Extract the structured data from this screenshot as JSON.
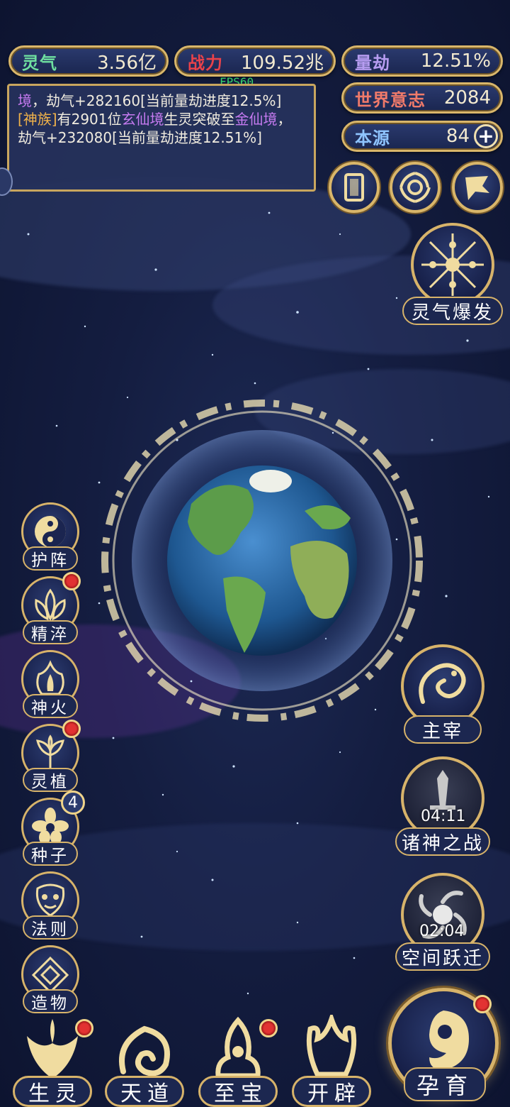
{
  "stats": {
    "lingqi": {
      "label": "灵气",
      "value": "3.56亿",
      "color": "#6fe0a0"
    },
    "zhanli": {
      "label": "战力",
      "value": "109.52兆",
      "color": "#e8424a"
    },
    "liangjie": {
      "label": "量劫",
      "value": "12.51%",
      "color": "#b69cf0"
    },
    "shijie": {
      "label": "世界意志",
      "value": "2084",
      "color": "#f07a6a"
    },
    "benyuan": {
      "label": "本源",
      "value": "84",
      "color": "#8fc4ff"
    }
  },
  "fps": "FPS60",
  "log": {
    "line1_a": "境",
    "line1_b": "，劫气+282160[当前量劫进度12.5%]",
    "line2_tag": "[神族]",
    "line2_a": "有2901位",
    "line2_b": "玄仙境",
    "line2_c": "生灵突破至",
    "line2_d": "金仙境",
    "line2_e": "，劫气+232080[当前量劫进度12.51%]"
  },
  "top_icons": [
    {
      "name": "card-icon"
    },
    {
      "name": "vortex-icon"
    },
    {
      "name": "flag-icon"
    }
  ],
  "burst": {
    "label": "灵气爆发"
  },
  "left_menu": [
    {
      "label": "护阵",
      "icon": "yinyang-icon",
      "red_dot": false,
      "badge": ""
    },
    {
      "label": "精淬",
      "icon": "lotus-flame-icon",
      "red_dot": true,
      "badge": ""
    },
    {
      "label": "神火",
      "icon": "fire-icon",
      "red_dot": false,
      "badge": ""
    },
    {
      "label": "灵植",
      "icon": "plant-icon",
      "red_dot": true,
      "badge": ""
    },
    {
      "label": "种子",
      "icon": "flower-icon",
      "red_dot": false,
      "badge": "4"
    },
    {
      "label": "法则",
      "icon": "mask-icon",
      "red_dot": false,
      "badge": ""
    },
    {
      "label": "造物",
      "icon": "rune-icon",
      "red_dot": false,
      "badge": ""
    }
  ],
  "right_menu": {
    "zhuzai": {
      "label": "主宰"
    },
    "zhushen": {
      "label": "诸神之战",
      "timer": "04:11"
    },
    "kongjian": {
      "label": "空间跃迁",
      "timer": "02:04"
    }
  },
  "bottom_menu": [
    {
      "label": "生灵",
      "red_dot": true
    },
    {
      "label": "天道",
      "red_dot": false
    },
    {
      "label": "至宝",
      "red_dot": true
    },
    {
      "label": "开辟",
      "red_dot": false
    }
  ],
  "yunyu": {
    "label": "孕育",
    "red_dot": true
  }
}
